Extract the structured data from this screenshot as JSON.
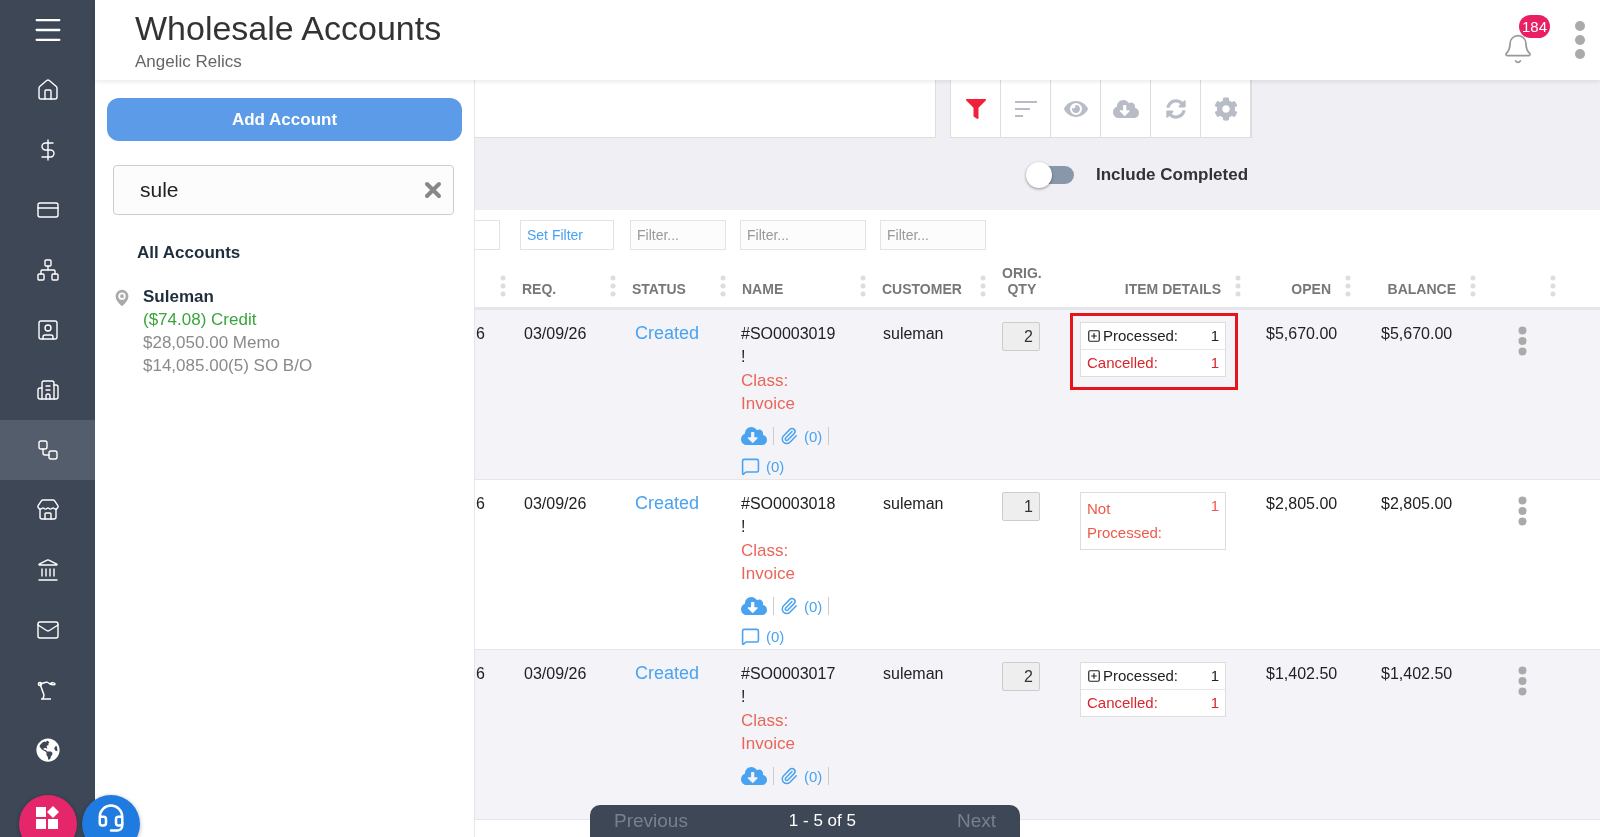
{
  "sidebar": {
    "items": [
      {
        "selected": false
      },
      {
        "selected": false
      },
      {
        "selected": false
      },
      {
        "selected": false
      },
      {
        "selected": false
      },
      {
        "selected": false
      },
      {
        "selected": true
      },
      {
        "selected": false
      },
      {
        "selected": false
      },
      {
        "selected": false
      },
      {
        "selected": false
      },
      {
        "selected": false
      }
    ]
  },
  "header": {
    "title": "Wholesale Accounts",
    "subtitle": "Angelic Relics",
    "notification_count": "184"
  },
  "accounts_panel": {
    "add_button": "Add Account",
    "search": {
      "value": "sule"
    },
    "section_title": "All Accounts",
    "accounts": [
      {
        "name": "Suleman",
        "credit": "($74.08) Credit",
        "memo": "$28,050.00 Memo",
        "backorder": "$14,085.00(5) SO B/O"
      }
    ]
  },
  "toolbar": {
    "buttons": [
      {
        "active": true
      },
      {
        "active": false
      },
      {
        "active": false
      },
      {
        "active": false
      },
      {
        "active": false
      },
      {
        "active": false
      }
    ]
  },
  "include_completed": {
    "label": "Include Completed",
    "on": false
  },
  "table": {
    "filters": [
      {
        "kind": "button",
        "text": "Set Filter"
      },
      {
        "kind": "input",
        "placeholder": "Filter..."
      },
      {
        "kind": "input",
        "placeholder": "Filter..."
      },
      {
        "kind": "input",
        "placeholder": "Filter..."
      }
    ],
    "columns": [
      "REQ.",
      "STATUS",
      "NAME",
      "CUSTOMER",
      "ORIG. QTY",
      "ITEM DETAILS",
      "OPEN",
      "BALANCE"
    ],
    "rows": [
      {
        "column_1": "6",
        "req": "03/09/26",
        "status": "Created",
        "number": "#SO0003019",
        "flag": "!",
        "class": "Class: Invoice",
        "attachments": "(0)",
        "comments": "(0)",
        "customer": "suleman",
        "qty": "2",
        "highlighted": true,
        "item_details": [
          {
            "kind": "processed",
            "label": "Processed:",
            "count": "1"
          },
          {
            "kind": "cancelled",
            "label": "Cancelled:",
            "count": "1"
          }
        ],
        "open": "$5,670.00",
        "balance": "$5,670.00"
      },
      {
        "column_1": "6",
        "req": "03/09/26",
        "status": "Created",
        "number": "#SO0003018",
        "flag": "!",
        "class": "Class: Invoice",
        "attachments": "(0)",
        "comments": "(0)",
        "customer": "suleman",
        "qty": "1",
        "highlighted": false,
        "item_details": [
          {
            "kind": "not_processed",
            "label": "Not Processed:",
            "count": "1"
          }
        ],
        "open": "$2,805.00",
        "balance": "$2,805.00"
      },
      {
        "column_1": "6",
        "req": "03/09/26",
        "status": "Created",
        "number": "#SO0003017",
        "flag": "!",
        "class": "Class: Invoice",
        "attachments": "(0)",
        "customer": "suleman",
        "qty": "2",
        "highlighted": false,
        "item_details": [
          {
            "kind": "processed",
            "label": "Processed:",
            "count": "1"
          },
          {
            "kind": "cancelled",
            "label": "Cancelled:",
            "count": "1"
          }
        ],
        "open": "$1,402.50",
        "balance": "$1,402.50"
      }
    ]
  },
  "pagination": {
    "previous": "Previous",
    "range": "1 - 5 of 5",
    "next": "Next",
    "previous_disabled": true,
    "next_disabled": true
  }
}
